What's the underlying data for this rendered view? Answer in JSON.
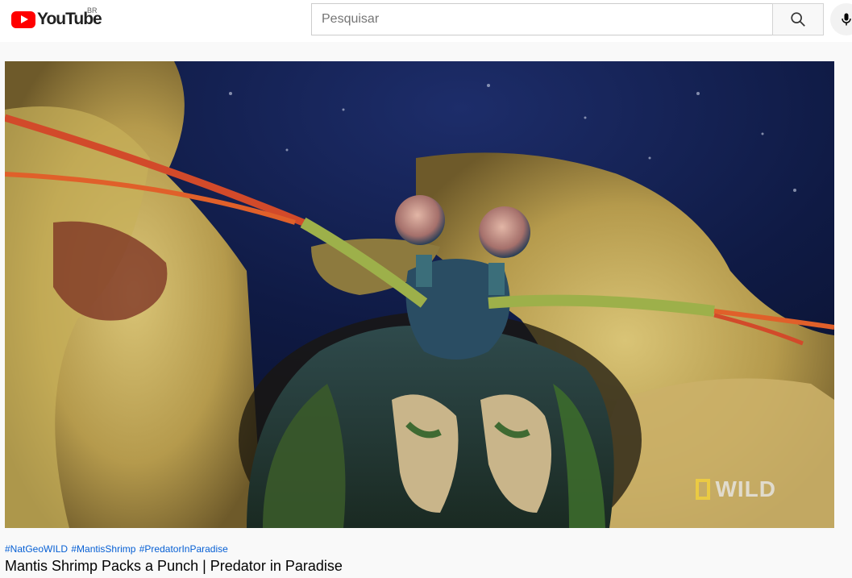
{
  "masthead": {
    "logo_text": "YouTube",
    "country_code": "BR",
    "search": {
      "placeholder": "Pesquisar",
      "value": ""
    },
    "icons": {
      "search": "search-icon",
      "mic": "microphone-icon",
      "logo": "youtube-logo-icon"
    }
  },
  "player": {
    "watermark_text": "WILD",
    "watermark_logo": "national-geographic-yellow-frame",
    "scene": "mantis shrimp in coral burrow"
  },
  "video": {
    "hashtags": [
      "#NatGeoWILD",
      "#MantisShrimp",
      "#PredatorInParadise"
    ],
    "title": "Mantis Shrimp Packs a Punch | Predator in Paradise"
  },
  "colors": {
    "brand_red": "#ff0000",
    "link_blue": "#065fd4",
    "background": "#f9f9f9",
    "watermark_yellow": "#f4d23b"
  }
}
